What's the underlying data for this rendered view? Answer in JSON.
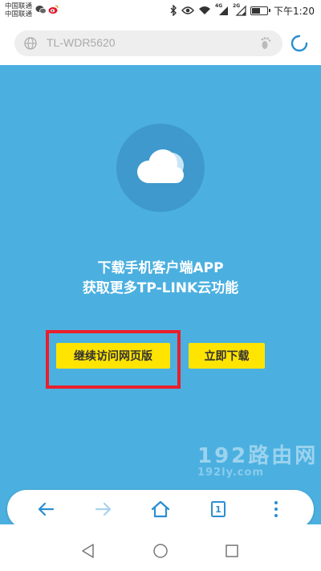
{
  "status_bar": {
    "carrier_1": "中国联通",
    "carrier_2": "中国联通",
    "network_1": "4G",
    "network_2": "2G",
    "time": "下午1:20",
    "battery_level": 0.55,
    "notification_icons": [
      "wechat-icon",
      "weibo-icon"
    ],
    "system_icons": [
      "bluetooth-icon",
      "eye-icon",
      "wifi-icon",
      "signal-icon",
      "signal-icon",
      "battery-icon"
    ]
  },
  "address_bar": {
    "url": "TL-WDR5620",
    "icons": [
      "globe-icon",
      "footprint-icon",
      "refresh-icon"
    ]
  },
  "page": {
    "background_color": "#4bb0e0",
    "promo_line_1": "下载手机客户端APP",
    "promo_line_2": "获取更多TP-LINK云功能",
    "continue_web_label": "继续访问网页版",
    "download_now_label": "立即下载",
    "button_color": "#ffe400",
    "highlight_color": "#e8202d",
    "watermark": "192路由网",
    "watermark_sub": "192ly.com"
  },
  "browser_toolbar": {
    "tab_count": "1",
    "icons": [
      "back-arrow-icon",
      "forward-arrow-icon",
      "home-icon",
      "tabs-icon",
      "more-menu-icon"
    ]
  },
  "nav_bar": {
    "icons": [
      "nav-back-icon",
      "nav-home-icon",
      "nav-recent-icon"
    ]
  }
}
